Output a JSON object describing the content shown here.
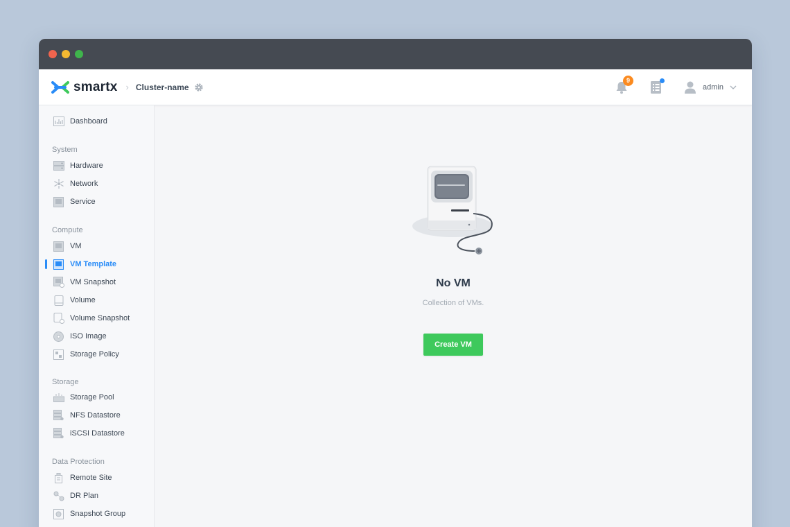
{
  "window": {
    "controls": {
      "close_color": "#f0644e",
      "minimize_color": "#f5b931",
      "maximize_color": "#3fb54c"
    }
  },
  "header": {
    "logo_text": "smartx",
    "cluster_name": "Cluster-name",
    "notification_count": "9",
    "user_name": "admin",
    "brand_colors": {
      "logo_blue": "#2a8cf7",
      "logo_green": "#3ec95c"
    }
  },
  "sidebar": {
    "dashboard": "Dashboard",
    "sections": {
      "system": "System",
      "compute": "Compute",
      "storage": "Storage",
      "data_protection": "Data Protection"
    },
    "system_items": [
      "Hardware",
      "Network",
      "Service"
    ],
    "compute_items": [
      "VM",
      "VM Template",
      "VM Snapshot",
      "Volume",
      "Volume Snapshot",
      "ISO Image",
      "Storage Policy"
    ],
    "storage_items": [
      "Storage Pool",
      "NFS Datastore",
      "iSCSI Datastore"
    ],
    "data_protection_items": [
      "Remote Site",
      "DR Plan",
      "Snapshot Group"
    ],
    "active_item": "VM Template",
    "active_color": "#2a8cf7"
  },
  "empty_state": {
    "title": "No VM",
    "subtitle": "Collection of VMs.",
    "button_label": "Create VM",
    "button_color": "#3ec95c"
  }
}
